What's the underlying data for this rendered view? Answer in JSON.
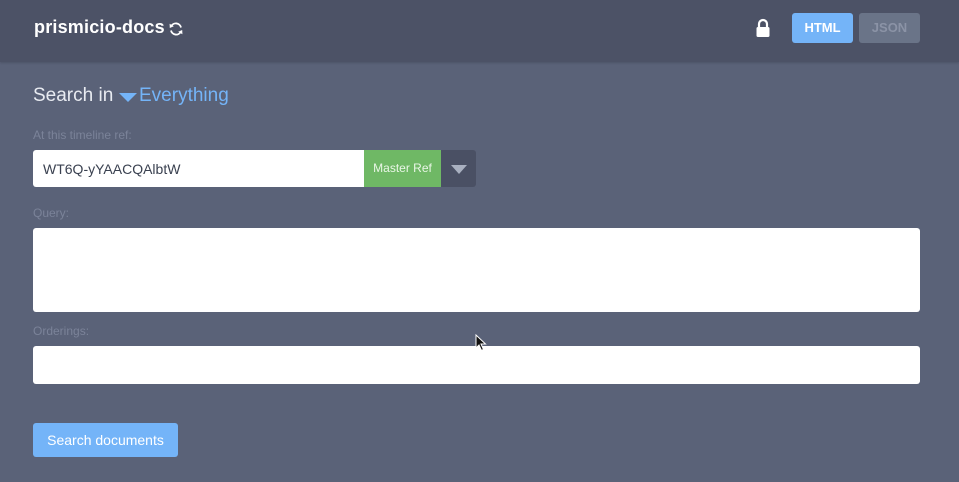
{
  "header": {
    "repo_name": "prismicio-docs",
    "formats": [
      {
        "label": "HTML",
        "active": true
      },
      {
        "label": "JSON",
        "active": false
      }
    ]
  },
  "search": {
    "search_in_label": "Search in",
    "scope_selected": "Everything",
    "timeline_ref_label": "At this timeline ref:",
    "ref_value": "WT6Q-yYAACQAlbtW",
    "master_ref_label": "Master Ref",
    "query_label": "Query:",
    "query_value": "",
    "orderings_label": "Orderings:",
    "orderings_value": "",
    "submit_label": "Search documents"
  },
  "colors": {
    "background": "#5a6278",
    "header_background": "#4c5266",
    "accent": "#74b4f8",
    "master_ref": "#6fb865"
  },
  "icons": {
    "refresh": "refresh-icon",
    "lock": "lock-icon",
    "scope_caret": "caret-down-icon",
    "ref_caret": "caret-down-icon",
    "pointer": "mouse-cursor-icon"
  }
}
